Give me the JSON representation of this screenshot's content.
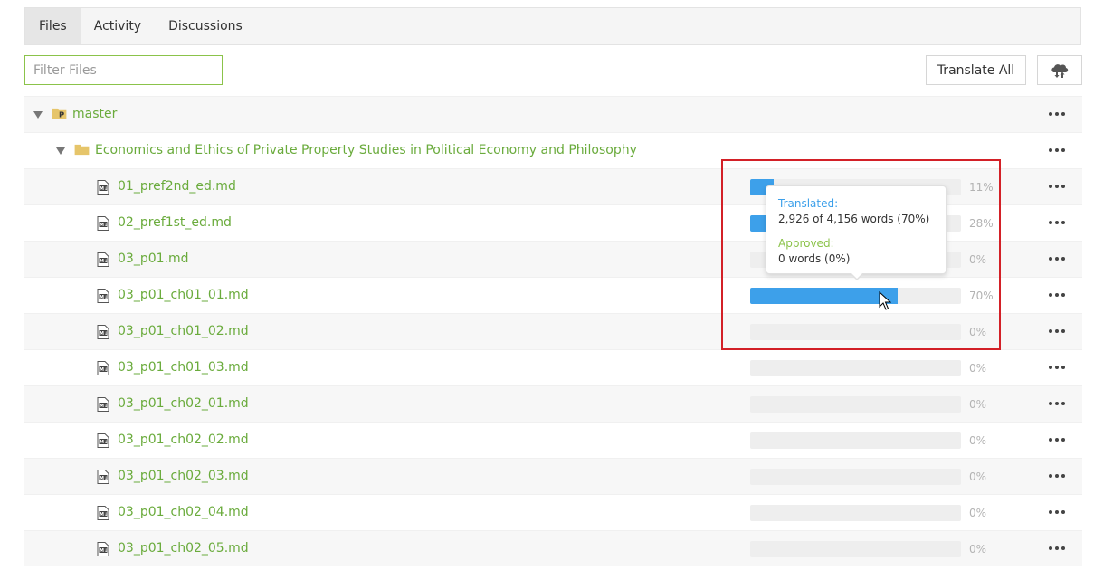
{
  "tabs": [
    {
      "label": "Files",
      "active": true
    },
    {
      "label": "Activity",
      "active": false
    },
    {
      "label": "Discussions",
      "active": false
    }
  ],
  "filter": {
    "placeholder": "Filter Files",
    "value": ""
  },
  "toolbar": {
    "translate_all_label": "Translate All",
    "download_icon": "cloud-download-icon"
  },
  "tree": {
    "branch": {
      "name": "master",
      "icon": "git-branch-folder-icon",
      "expanded": true
    },
    "folder": {
      "name": "Economics and Ethics of Private Property Studies in Political Economy and Philosophy",
      "icon": "folder-icon",
      "expanded": true
    },
    "files": [
      {
        "name": "01_pref2nd_ed.md",
        "progress": 11,
        "percent_label": "11%"
      },
      {
        "name": "02_pref1st_ed.md",
        "progress": 28,
        "percent_label": "28%"
      },
      {
        "name": "03_p01.md",
        "progress": 0,
        "percent_label": "0%"
      },
      {
        "name": "03_p01_ch01_01.md",
        "progress": 70,
        "percent_label": "70%"
      },
      {
        "name": "03_p01_ch01_02.md",
        "progress": 0,
        "percent_label": "0%"
      },
      {
        "name": "03_p01_ch01_03.md",
        "progress": 0,
        "percent_label": "0%"
      },
      {
        "name": "03_p01_ch02_01.md",
        "progress": 0,
        "percent_label": "0%"
      },
      {
        "name": "03_p01_ch02_02.md",
        "progress": 0,
        "percent_label": "0%"
      },
      {
        "name": "03_p01_ch02_03.md",
        "progress": 0,
        "percent_label": "0%"
      },
      {
        "name": "03_p01_ch02_04.md",
        "progress": 0,
        "percent_label": "0%"
      },
      {
        "name": "03_p01_ch02_05.md",
        "progress": 0,
        "percent_label": "0%"
      }
    ]
  },
  "tooltip": {
    "translated_label": "Translated:",
    "translated_value": "2,926 of 4,156 words (70%)",
    "approved_label": "Approved:",
    "approved_value": "0 words (0%)"
  },
  "colors": {
    "accent_green": "#6aab3c",
    "progress_blue": "#3da0ea",
    "highlight_red": "#d32027"
  }
}
